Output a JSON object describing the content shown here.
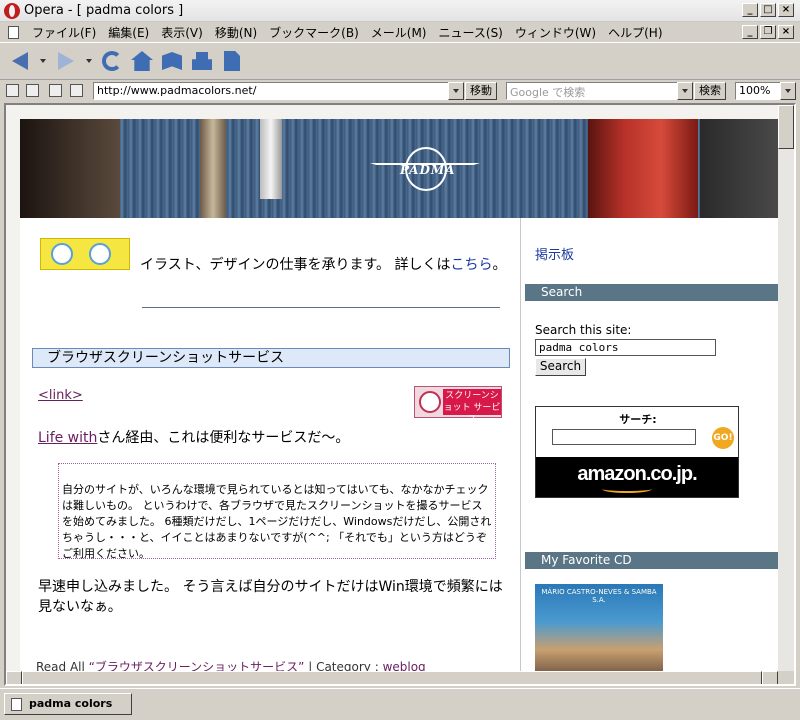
{
  "window": {
    "title": "Opera - [ padma colors ]"
  },
  "menu": [
    "ファイル(F)",
    "編集(E)",
    "表示(V)",
    "移動(N)",
    "ブックマーク(B)",
    "メール(M)",
    "ニュース(S)",
    "ウィンドウ(W)",
    "ヘルプ(H)"
  ],
  "addressbar": {
    "url": "http://www.padmacolors.net/",
    "go_label": "移動",
    "search_placeholder": "Google で検索",
    "search_label": "検索",
    "zoom": "100%"
  },
  "page": {
    "banner_logo": "PADMA",
    "intro_text": "イラスト、デザインの仕事を承ります。 詳しくは",
    "intro_link": "こちら",
    "intro_end": "。",
    "post_title": "ブラウザスクリーンショットサービス",
    "link_tag": "<link>",
    "badge_text": "スクリーンショット サービス",
    "line1_link": "Life with",
    "line1_text": "さん経由、これは便利なサービスだ〜。",
    "quote": "自分のサイトが、いろんな環境で見られているとは知ってはいても、なかなかチェックは難しいもの。 というわけで、各ブラウザで見たスクリーンショットを撮るサービスを始めてみました。 6種類だけだし、1ページだけだし、Windowsだけだし、公開されちゃうし・・・と、イイことはあまりないですが(^^; 「それでも」という方はどうぞご利用ください。",
    "para2": "早速申し込みました。 そう言えば自分のサイトだけはWin環境で頻繁には見ないなぁ。",
    "readall_prefix": "Read All",
    "readall_link": "“ブラウザスクリーンショットサービス”",
    "readall_sep": " | Category : ",
    "readall_cat": "weblog"
  },
  "sidebar": {
    "bbs": "掲示板",
    "search_head": "Search",
    "search_label": "Search this site:",
    "search_value": "padma colors",
    "search_button": "Search",
    "amazon_label": "サーチ:",
    "amazon_go": "GO!",
    "amazon_logo": "amazon.co.jp.",
    "cd_head": "My Favorite CD",
    "cd_text": "MÁRIO CASTRO-NEVES & SAMBA S.A."
  },
  "status": {
    "tab": "padma colors"
  }
}
